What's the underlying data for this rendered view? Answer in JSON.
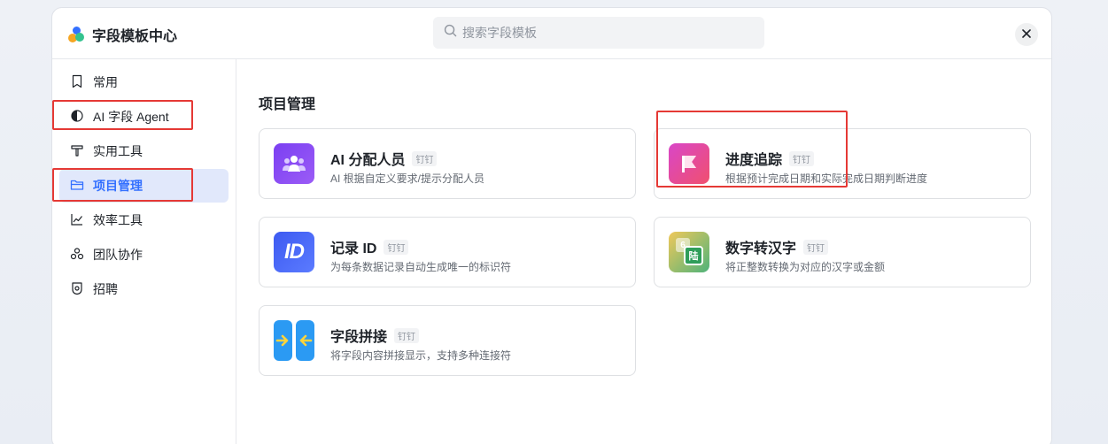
{
  "header": {
    "title": "字段模板中心",
    "search_placeholder": "搜索字段模板",
    "logo_icon": "feishu-logo-icon",
    "close_icon": "close-icon"
  },
  "sidebar": {
    "items": [
      {
        "label": "常用",
        "icon": "bookmark-icon"
      },
      {
        "label": "AI 字段 Agent",
        "icon": "half-circle-icon"
      },
      {
        "label": "实用工具",
        "icon": "hammer-icon"
      },
      {
        "label": "项目管理",
        "icon": "folder-icon",
        "active": true
      },
      {
        "label": "效率工具",
        "icon": "chart-line-icon"
      },
      {
        "label": "团队协作",
        "icon": "people-icon"
      },
      {
        "label": "招聘",
        "icon": "badge-icon"
      }
    ]
  },
  "main": {
    "section_title": "项目管理",
    "cards": [
      {
        "title": "AI 分配人员",
        "tag": "钉钉",
        "desc": "AI 根据自定义要求/提示分配人员",
        "icon": "people-group-icon"
      },
      {
        "title": "进度追踪",
        "tag": "钉钉",
        "desc": "根据预计完成日期和实际完成日期判断进度",
        "icon": "flag-icon"
      },
      {
        "title": "记录 ID",
        "tag": "钉钉",
        "desc": "为每条数据记录自动生成唯一的标识符",
        "icon": "id-icon",
        "icon_text": "ID"
      },
      {
        "title": "数字转汉字",
        "tag": "钉钉",
        "desc": "将正整数转换为对应的汉字或金额",
        "icon": "number-convert-icon",
        "icon_text": "陆"
      },
      {
        "title": "字段拼接",
        "tag": "钉钉",
        "desc": "将字段内容拼接显示，支持多种连接符",
        "icon": "merge-arrows-icon"
      }
    ]
  },
  "colors": {
    "accent": "#3370ff",
    "active_bg": "#e1e8fb",
    "highlight_red": "#e53935"
  }
}
